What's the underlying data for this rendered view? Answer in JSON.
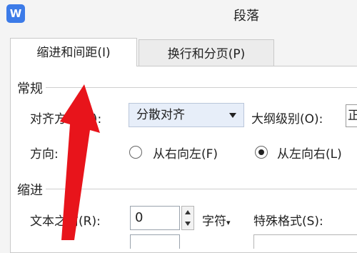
{
  "window": {
    "title": "段落",
    "app_icon": "W"
  },
  "tabs": [
    {
      "label": "缩进和间距(I)",
      "active": true
    },
    {
      "label": "换行和分页(P)",
      "active": false
    }
  ],
  "general": {
    "section_label": "常规",
    "alignment_label": "对齐方式(G):",
    "alignment_value": "分散对齐",
    "outline_label": "大纲级别(O):",
    "outline_value": "正",
    "direction_label": "方向:",
    "direction_options": [
      "从右向左(F)",
      "从左向右(L)"
    ],
    "direction_selected": 1
  },
  "indent": {
    "section_label": "缩进",
    "before_text_label": "文本之前(R):",
    "before_text_value": "0",
    "unit_label": "字符",
    "special_label": "特殊格式(S):"
  },
  "colors": {
    "accent_select_bg": "#e7eef9",
    "arrow": "#e8141b",
    "app_icon_bg": "#3c7be8"
  }
}
